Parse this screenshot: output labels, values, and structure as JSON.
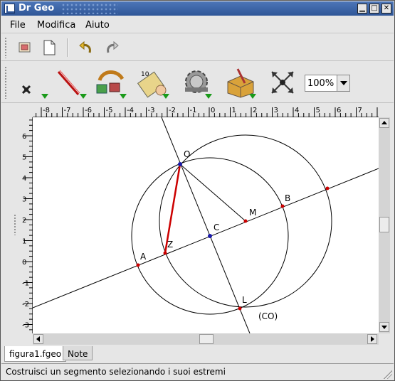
{
  "window": {
    "title": "Dr Geo"
  },
  "menubar": {
    "items": [
      "File",
      "Modifica",
      "Aiuto"
    ]
  },
  "toolbar": {
    "zoom": "100%"
  },
  "rulers": {
    "horizontal_ticks": [
      "-8",
      "-7",
      "-6",
      "-5",
      "-4",
      "-3",
      "-2",
      "-1",
      "0",
      "1",
      "2",
      "3",
      "4",
      "5",
      "6",
      "7"
    ],
    "vertical_ticks": [
      "6",
      "5",
      "4",
      "3",
      "2",
      "1",
      "0",
      "-1",
      "-2",
      "-3"
    ]
  },
  "canvas": {
    "labels": {
      "O": "O",
      "M": "M",
      "B": "B",
      "C": "C",
      "Z": "Z",
      "A": "A",
      "L": "L",
      "CO": "(CO)"
    },
    "colors": {
      "line": "#000000",
      "segment": "#cc0000",
      "point_red": "#cc0000",
      "point_blue": "#1a1aaa"
    }
  },
  "tabs": [
    "figura1.fgeo",
    "Note"
  ],
  "status": {
    "message": "Costruisci un segmento selezionando i suoi estremi"
  }
}
